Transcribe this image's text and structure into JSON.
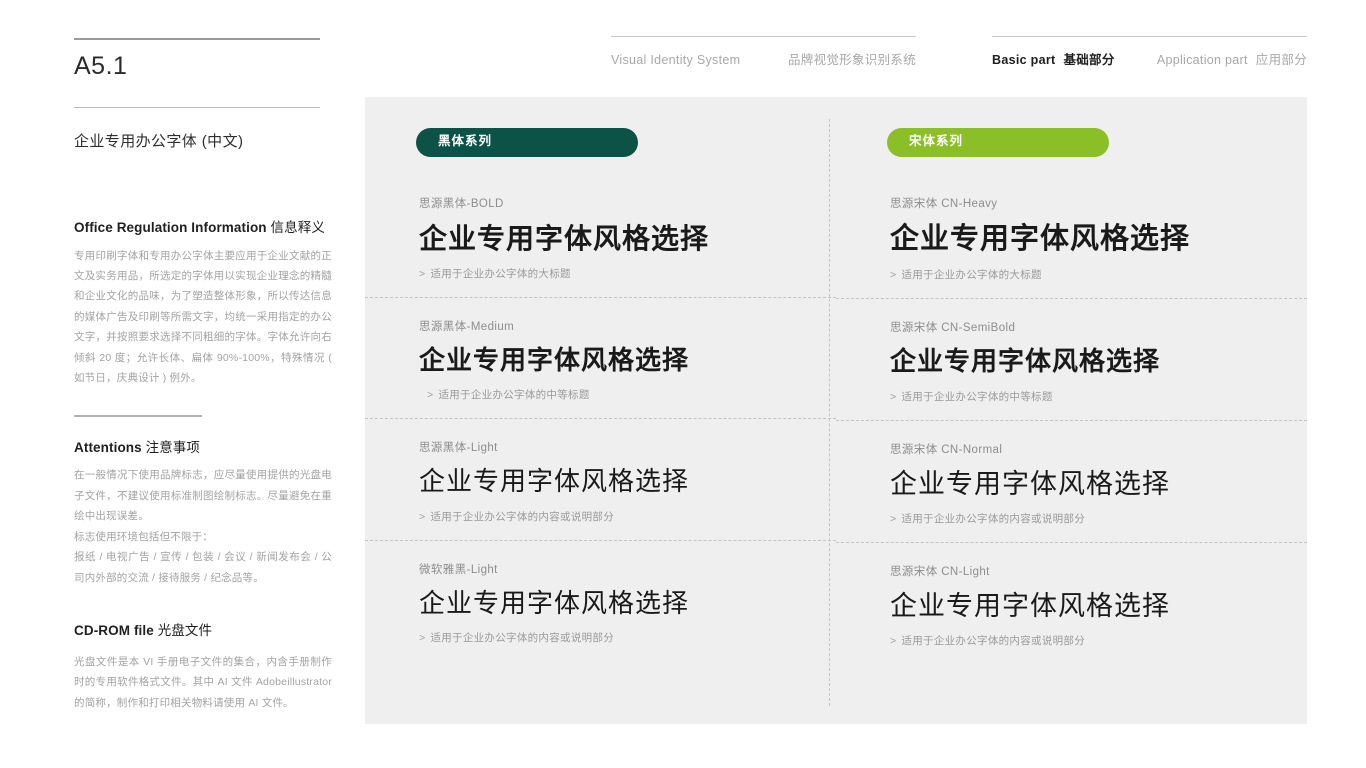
{
  "sidebar": {
    "code": "A5.1",
    "subtitle": "企业专用办公字体 (中文)",
    "sections": [
      {
        "heading_en": "Office Regulation Information",
        "heading_cn": "信息释义",
        "body": "专用印刷字体和专用办公字体主要应用于企业文献的正文及实务用品，所选定的字体用以实现企业理念的精髓和企业文化的品味，为了塑造整体形象，所以传达信息的媒体广告及印刷等所需文字，均统一采用指定的办公文字，并按照要求选择不同粗细的字体。字体允许向右倾斜 20 度；允许长体、扁体 90%-100%，特殊情况 ( 如节日，庆典设计 ) 例外。"
      },
      {
        "heading_en": "Attentions",
        "heading_cn": "注意事项",
        "body": "在一般情况下使用品牌标志，应尽量使用提供的光盘电子文件，不建议使用标准制图绘制标志。尽量避免在重绘中出现误差。",
        "body2": "标志使用环境包括但不限于：",
        "body3": "报纸 / 电视广告 / 宣传 / 包装 / 会议 / 新闻发布会 / 公司内外部的交流 / 接待服务 / 纪念品等。"
      },
      {
        "heading_en": "CD-ROM file",
        "heading_cn": "光盘文件",
        "body": "光盘文件是本 VI 手册电子文件的集合，内含手册制作时的专用软件格式文件。其中 AI 文件 Adobeillustrator 的简称，制作和打印相关物料请使用 AI 文件。"
      }
    ]
  },
  "header": {
    "left": {
      "en": "Visual Identity System",
      "cn": "品牌视觉形象识别系统"
    },
    "right": {
      "active_en": "Basic part",
      "active_cn": "基础部分",
      "inactive_en": "Application part",
      "inactive_cn": "应用部分"
    }
  },
  "colors": {
    "pill_dark": "#0c5247",
    "pill_green": "#8bbf27",
    "panel_bg": "#efefef"
  },
  "columns": [
    {
      "pill_label": "黑体系列",
      "pill_style": "dark",
      "samples": [
        {
          "name": "思源黑体-BOLD",
          "specimen": "企业专用字体风格选择",
          "desc": "适用于企业办公字体的大标题",
          "marker": ">"
        },
        {
          "name": "思源黑体-Medium",
          "specimen": "企业专用字体风格选择",
          "desc": "适用于企业办公字体的中等标题",
          "marker": ">"
        },
        {
          "name": "思源黑体-Light",
          "specimen": "企业专用字体风格选择",
          "desc": "适用于企业办公字体的内容或说明部分",
          "marker": ">"
        },
        {
          "name": "微软雅黑-Light",
          "specimen": "企业专用字体风格选择",
          "desc": "适用于企业办公字体的内容或说明部分",
          "marker": ">"
        }
      ]
    },
    {
      "pill_label": "宋体系列",
      "pill_style": "green",
      "samples": [
        {
          "name": "思源宋体 CN-Heavy",
          "specimen": "企业专用字体风格选择",
          "desc": "适用于企业办公字体的大标题",
          "marker": ">"
        },
        {
          "name": "思源宋体 CN-SemiBold",
          "specimen": "企业专用字体风格选择",
          "desc": "适用于企业办公字体的中等标题",
          "marker": ">"
        },
        {
          "name": "思源宋体 CN-Normal",
          "specimen": "企业专用字体风格选择",
          "desc": "适用于企业办公字体的内容或说明部分",
          "marker": ">"
        },
        {
          "name": "思源宋体 CN-Light",
          "specimen": "企业专用字体风格选择",
          "desc": "适用于企业办公字体的内容或说明部分",
          "marker": ">"
        }
      ]
    }
  ]
}
